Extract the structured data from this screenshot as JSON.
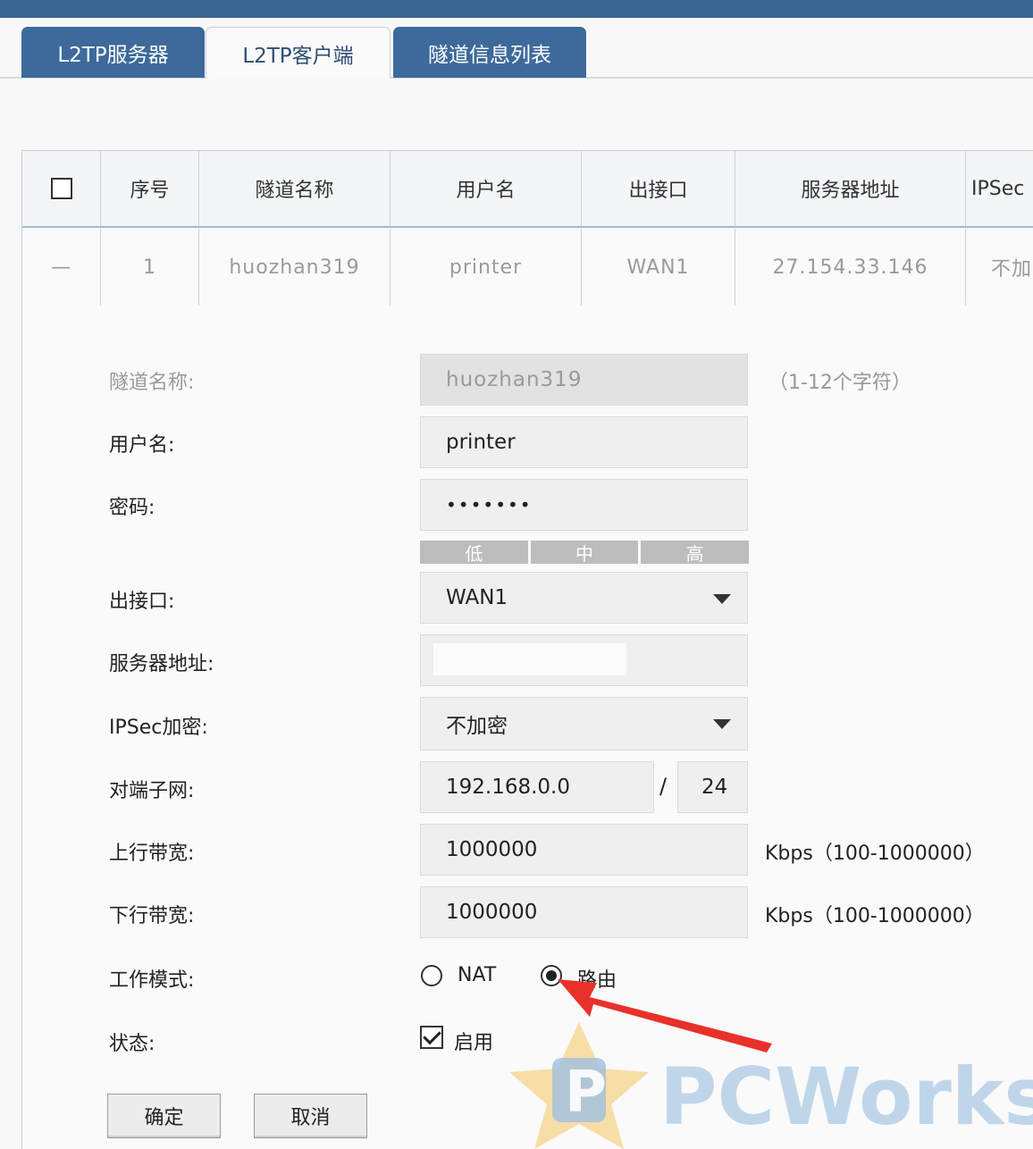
{
  "tabs": [
    {
      "label": "L2TP服务器"
    },
    {
      "label": "L2TP客户端"
    },
    {
      "label": "隧道信息列表"
    }
  ],
  "table": {
    "headers": [
      "序号",
      "隧道名称",
      "用户名",
      "出接口",
      "服务器地址",
      "IPSec"
    ],
    "row": [
      "—",
      "1",
      "huozhan319",
      "printer",
      "WAN1",
      "27.154.33.146",
      "不加"
    ]
  },
  "form": {
    "tunnel_name": {
      "label": "隧道名称:",
      "value": "huozhan319",
      "hint": "（1-12个字符）"
    },
    "username": {
      "label": "用户名:",
      "value": "printer"
    },
    "password": {
      "label": "密码:",
      "value": "•••••••"
    },
    "strength": [
      "低",
      "中",
      "高"
    ],
    "out_interface": {
      "label": "出接口:",
      "value": "WAN1"
    },
    "server_addr": {
      "label": "服务器地址:",
      "value": ""
    },
    "ipsec": {
      "label": "IPSec加密:",
      "value": "不加密"
    },
    "remote_subnet": {
      "label": "对端子网:",
      "ip": "192.168.0.0",
      "sep": "/",
      "mask": "24"
    },
    "up_bw": {
      "label": "上行带宽:",
      "value": "1000000",
      "hint": "Kbps（100-1000000）"
    },
    "down_bw": {
      "label": "下行带宽:",
      "value": "1000000",
      "hint": "Kbps（100-1000000）"
    },
    "mode": {
      "label": "工作模式:",
      "nat": "NAT",
      "route": "路由",
      "selected": "route"
    },
    "status": {
      "label": "状态:",
      "enable": "启用"
    }
  },
  "buttons": {
    "ok": "确定",
    "cancel": "取消"
  },
  "watermark": {
    "brand": "PCWorks"
  },
  "colors": {
    "header_blue": "#3a6591",
    "tab_blue": "#3d6a9b",
    "arrow": "#e8312b"
  }
}
